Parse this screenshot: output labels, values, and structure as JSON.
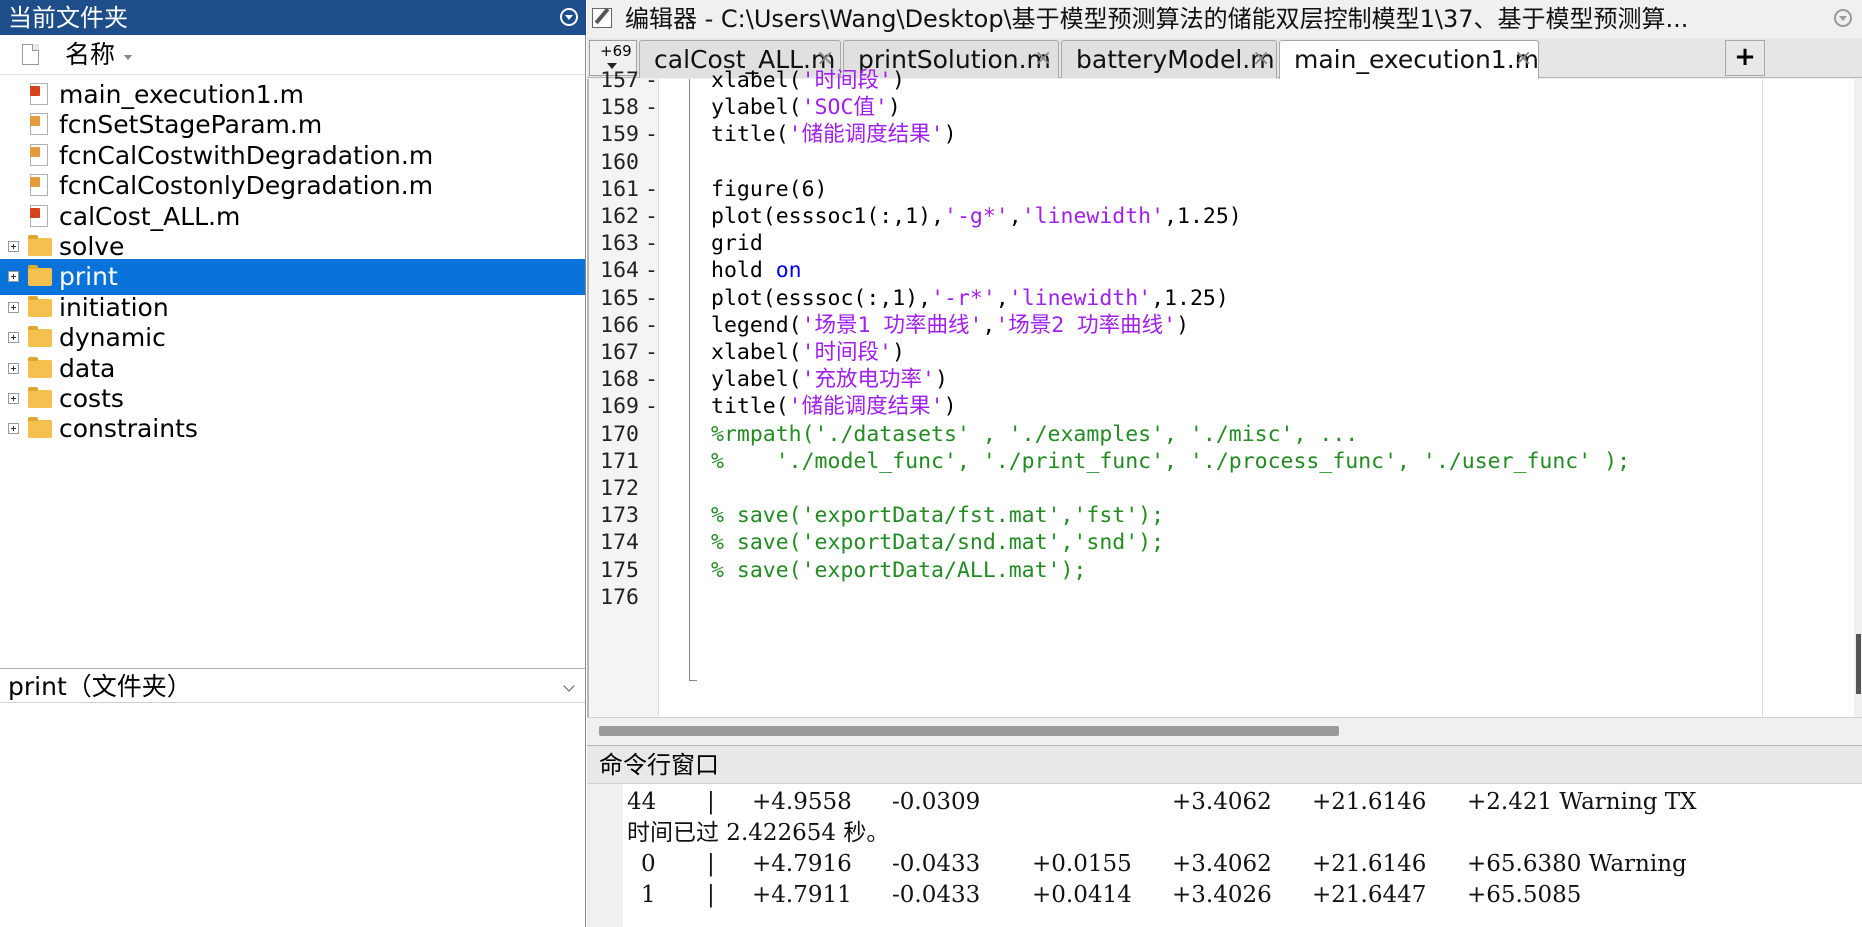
{
  "left_panel": {
    "title": "当前文件夹",
    "column_name": "名称",
    "files": [
      {
        "name": "main_execution1.m",
        "kind": "m"
      },
      {
        "name": "fcnSetStageParam.m",
        "kind": "m-alt"
      },
      {
        "name": "fcnCalCostwithDegradation.m",
        "kind": "m-alt"
      },
      {
        "name": "fcnCalCostonlyDegradation.m",
        "kind": "m-alt"
      },
      {
        "name": "calCost_ALL.m",
        "kind": "m"
      }
    ],
    "folders": [
      "solve",
      "print",
      "initiation",
      "dynamic",
      "data",
      "costs",
      "constraints"
    ],
    "selected_folder": "print",
    "details_label": "print（文件夹）",
    "accent_color": "#1d4e8a",
    "selection_color": "#0a73d9"
  },
  "editor": {
    "title": "编辑器 - C:\\Users\\Wang\\Desktop\\基于模型预测算法的储能双层控制模型1\\37、基于模型预测算...",
    "tab_overflow_count": "+69",
    "tabs": [
      {
        "label": "calCost_ALL.m",
        "close": "×",
        "active": false
      },
      {
        "label": "printSolution.m",
        "close": "×",
        "active": false
      },
      {
        "label": "batteryModel.m",
        "close": "×",
        "active": false
      },
      {
        "label": "main_execution1.m",
        "close": "×",
        "active": true
      }
    ],
    "new_tab_label": "+",
    "lines": [
      {
        "n": "157",
        "dash": "-",
        "parts": [
          [
            "t",
            "xlabel("
          ],
          [
            "s",
            "'时间段'"
          ],
          [
            "t",
            ")"
          ]
        ]
      },
      {
        "n": "158",
        "dash": "-",
        "parts": [
          [
            "t",
            "ylabel("
          ],
          [
            "s",
            "'SOC值'"
          ],
          [
            "t",
            ")"
          ]
        ]
      },
      {
        "n": "159",
        "dash": "-",
        "parts": [
          [
            "t",
            "title("
          ],
          [
            "s",
            "'储能调度结果'"
          ],
          [
            "t",
            ")"
          ]
        ]
      },
      {
        "n": "160",
        "dash": "",
        "parts": []
      },
      {
        "n": "161",
        "dash": "-",
        "parts": [
          [
            "t",
            "figure(6)"
          ]
        ]
      },
      {
        "n": "162",
        "dash": "-",
        "parts": [
          [
            "t",
            "plot(esssoc1(:,1),"
          ],
          [
            "s",
            "'-g*'"
          ],
          [
            "t",
            ","
          ],
          [
            "s",
            "'linewidth'"
          ],
          [
            "t",
            ",1.25)"
          ]
        ]
      },
      {
        "n": "163",
        "dash": "-",
        "parts": [
          [
            "t",
            "grid"
          ]
        ]
      },
      {
        "n": "164",
        "dash": "-",
        "parts": [
          [
            "t",
            "hold "
          ],
          [
            "k",
            "on"
          ]
        ]
      },
      {
        "n": "165",
        "dash": "-",
        "parts": [
          [
            "t",
            "plot(esssoc(:,1),"
          ],
          [
            "s",
            "'-r*'"
          ],
          [
            "t",
            ","
          ],
          [
            "s",
            "'linewidth'"
          ],
          [
            "t",
            ",1.25)"
          ]
        ]
      },
      {
        "n": "166",
        "dash": "-",
        "parts": [
          [
            "t",
            "legend("
          ],
          [
            "s",
            "'场景1 功率曲线'"
          ],
          [
            "t",
            ","
          ],
          [
            "s",
            "'场景2 功率曲线'"
          ],
          [
            "t",
            ")"
          ]
        ]
      },
      {
        "n": "167",
        "dash": "-",
        "parts": [
          [
            "t",
            "xlabel("
          ],
          [
            "s",
            "'时间段'"
          ],
          [
            "t",
            ")"
          ]
        ]
      },
      {
        "n": "168",
        "dash": "-",
        "parts": [
          [
            "t",
            "ylabel("
          ],
          [
            "s",
            "'充放电功率'"
          ],
          [
            "t",
            ")"
          ]
        ]
      },
      {
        "n": "169",
        "dash": "-",
        "parts": [
          [
            "t",
            "title("
          ],
          [
            "s",
            "'储能调度结果'"
          ],
          [
            "t",
            ")"
          ]
        ]
      },
      {
        "n": "170",
        "dash": "",
        "parts": [
          [
            "c",
            "%rmpath('./datasets' , './examples', './misc', ..."
          ]
        ]
      },
      {
        "n": "171",
        "dash": "",
        "parts": [
          [
            "c",
            "%    './model_func', './print_func', './process_func', './user_func' );"
          ]
        ]
      },
      {
        "n": "172",
        "dash": "",
        "parts": []
      },
      {
        "n": "173",
        "dash": "",
        "parts": [
          [
            "c",
            "% save('exportData/fst.mat','fst');"
          ]
        ]
      },
      {
        "n": "174",
        "dash": "",
        "parts": [
          [
            "c",
            "% save('exportData/snd.mat','snd');"
          ]
        ]
      },
      {
        "n": "175",
        "dash": "",
        "parts": [
          [
            "c",
            "% save('exportData/ALL.mat');"
          ]
        ]
      },
      {
        "n": "176",
        "dash": "",
        "parts": []
      }
    ],
    "colors": {
      "string": "#a020f0",
      "keyword": "#0000ff",
      "comment": "#228b22"
    }
  },
  "command_window": {
    "title": "命令行窗口",
    "rows": [
      {
        "cells": [
          "44",
          "|",
          "+4.9558",
          "-0.0309",
          "",
          "+3.4062",
          "+21.6146",
          "+2.421 Warning TX"
        ]
      },
      {
        "text": "时间已过 2.422654 秒。"
      },
      {
        "cells": [
          "0",
          "|",
          "+4.7916",
          "-0.0433",
          "+0.0155",
          "+3.4062",
          "+21.6146",
          "+65.6380 Warning"
        ]
      },
      {
        "cells": [
          "1",
          "|",
          "+4.7911",
          "-0.0433",
          "+0.0414",
          "+3.4026",
          "+21.6447",
          "+65.5085"
        ]
      }
    ]
  }
}
